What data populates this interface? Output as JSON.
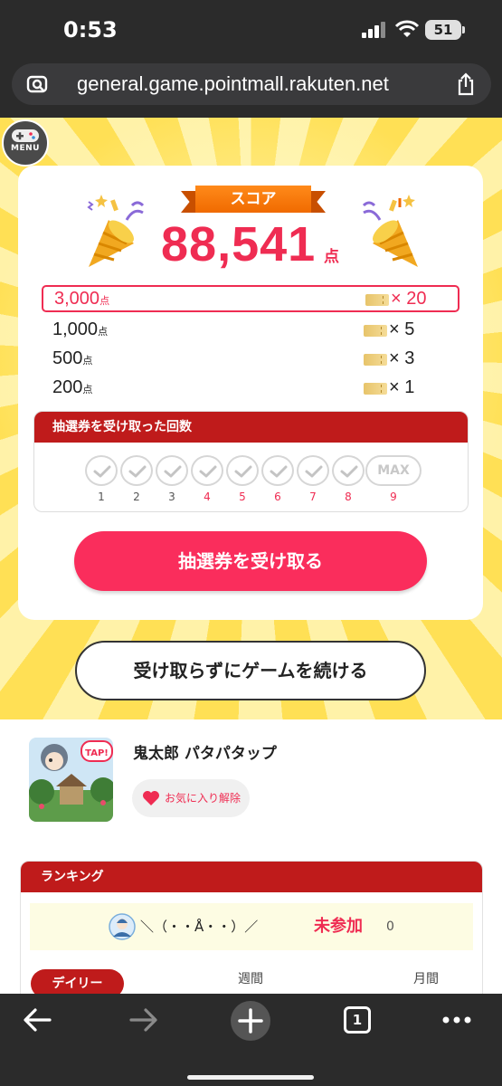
{
  "status": {
    "time": "0:53",
    "battery": "51"
  },
  "browser": {
    "url": "general.game.pointmall.rakuten.net",
    "tab_count": "1"
  },
  "game": {
    "menu_label": "MENU",
    "score_label": "スコア",
    "score": "88,541",
    "score_unit": "点",
    "tiers": [
      {
        "points": "3,000",
        "unit": "点",
        "count": "× 20",
        "active": true
      },
      {
        "points": "1,000",
        "unit": "点",
        "count": "× 5"
      },
      {
        "points": "500",
        "unit": "点",
        "count": "× 3"
      },
      {
        "points": "200",
        "unit": "点",
        "count": "× 1"
      }
    ],
    "received_title": "抽選券を受け取った回数",
    "received_count": 8,
    "max_label": "MAX",
    "check_numbers": [
      "1",
      "2",
      "3",
      "4",
      "5",
      "6",
      "7",
      "8",
      "9"
    ],
    "receive_button": "抽選券を受け取る",
    "continue_button": "受け取らずにゲームを続ける"
  },
  "game_info": {
    "title": "鬼太郎 パタパタップ",
    "thumb_text": "TAP!",
    "favorite_label": "お気に入り解除"
  },
  "ranking": {
    "title": "ランキング",
    "user_name": "＼（・・Å・・）／",
    "status": "未参加",
    "score": "0",
    "tabs": [
      "デイリー",
      "週間",
      "月間"
    ]
  },
  "colors": {
    "accent": "#ef2c52",
    "header_red": "#bf1b1b",
    "button_pink": "#fa2d5c",
    "yellow": "#ffe055"
  },
  "icons": [
    "camera-search-icon",
    "share-icon",
    "gamepad-icon",
    "party-popper-icon",
    "ticket-icon",
    "checkmark-icon",
    "heart-icon",
    "user-avatar-icon",
    "back-arrow-icon",
    "forward-arrow-icon",
    "plus-icon",
    "more-icon"
  ]
}
